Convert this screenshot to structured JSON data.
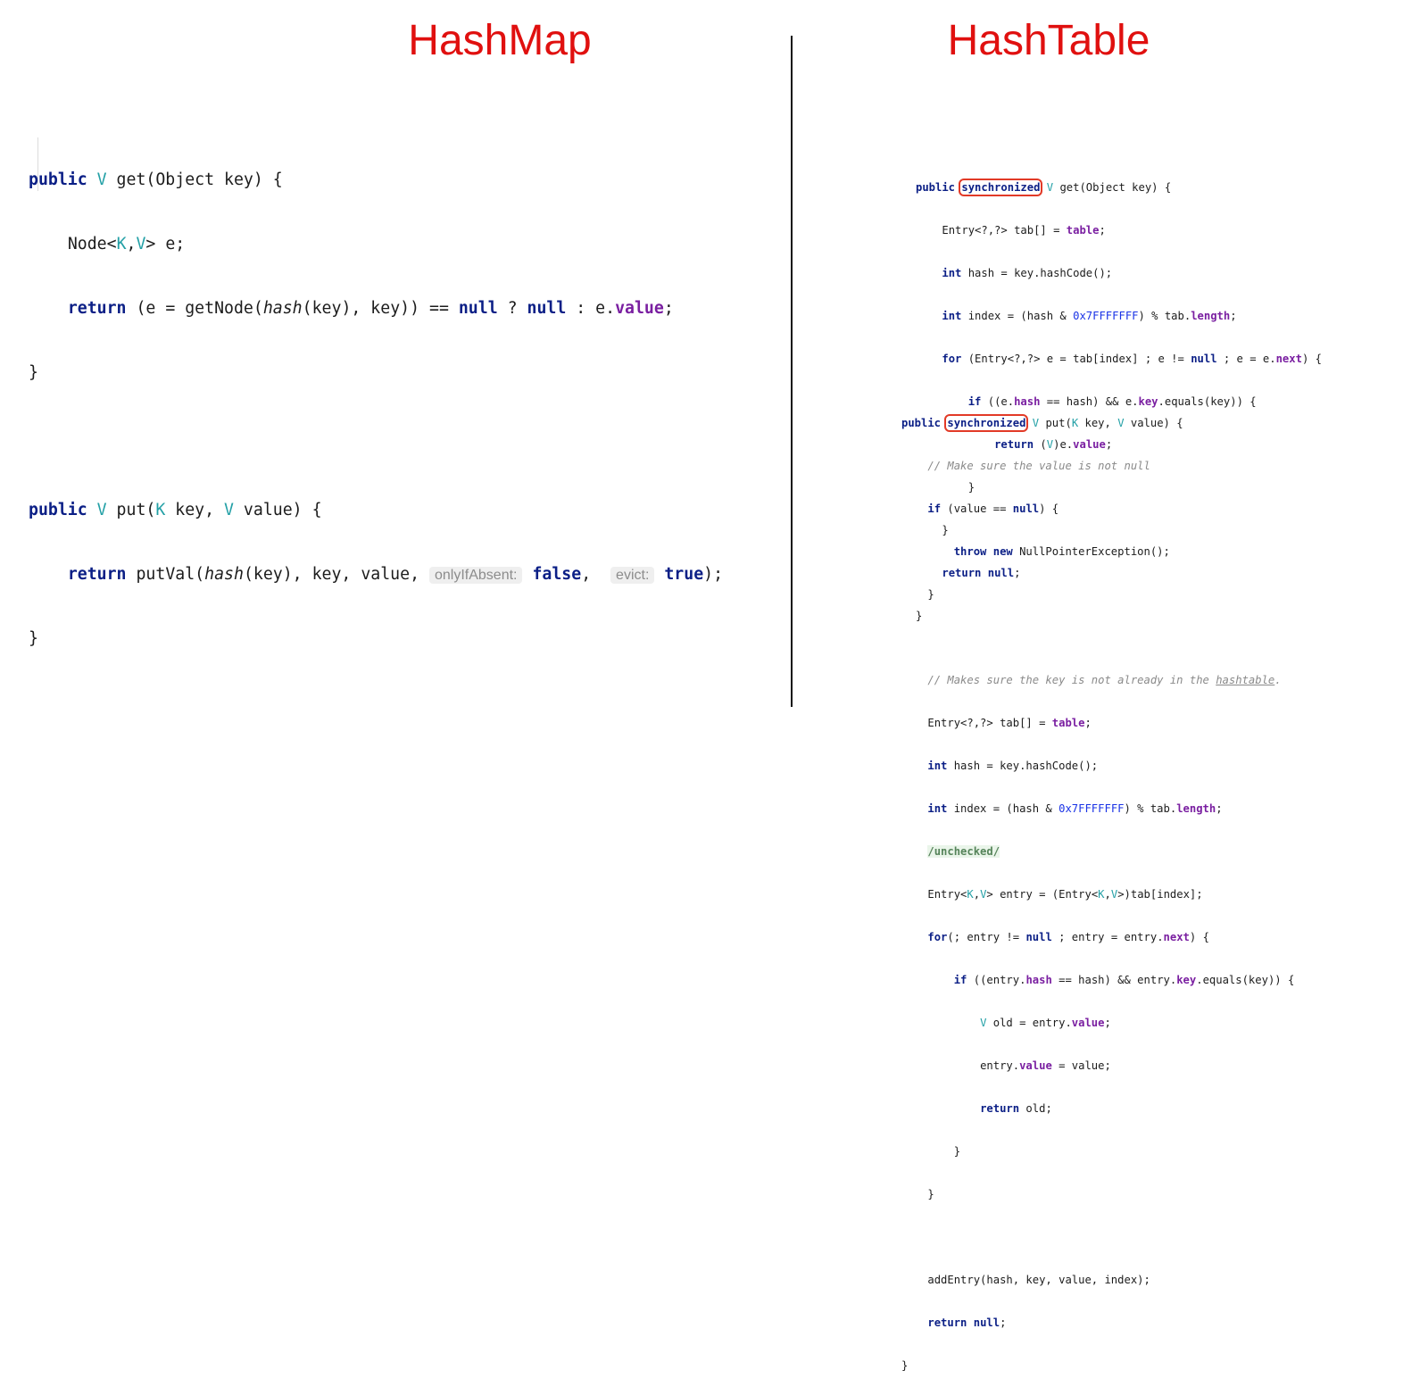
{
  "titles": {
    "left": "HashMap",
    "right": "HashTable"
  },
  "hashmap": {
    "get": {
      "l1": {
        "kw": "public",
        "type": "V",
        "rest": " get(Object key) {"
      },
      "l2": {
        "a": "Node<",
        "k": "K",
        "comma": ",",
        "v": "V",
        "b": "> e;"
      },
      "l3": {
        "ret": "return",
        "a": " (e = getNode(",
        "hash": "hash",
        "b": "(key), key)) == ",
        "null1": "null",
        "q": " ? ",
        "null2": "null",
        "c": " : e.",
        "field": "value",
        "end": ";"
      },
      "l4": "}"
    },
    "put": {
      "l1": {
        "kw": "public",
        "type": "V",
        "a": " put(",
        "k": "K",
        "b": " key, ",
        "v": "V",
        "c": " value) {"
      },
      "l2": {
        "ret": "return",
        "a": " putVal(",
        "hash": "hash",
        "b": "(key), key, value, ",
        "hint1": "onlyIfAbsent:",
        "false": "false",
        "c": ", ",
        "hint2": "evict:",
        "true": "true",
        "end": ");"
      },
      "l3": "}"
    }
  },
  "hashtable": {
    "get": {
      "l1": {
        "kw": "public",
        "sync": "synchronized",
        "type": "V",
        "rest": " get(Object key) {"
      },
      "l2": {
        "a": "Entry<?,?> tab[] = ",
        "field": "table",
        "end": ";"
      },
      "l3": {
        "kw": "int",
        "rest": " hash = key.hashCode();"
      },
      "l4": {
        "kw": "int",
        "a": " index = (hash & ",
        "num": "0x7FFFFFFF",
        "b": ") % tab.",
        "field": "length",
        "end": ";"
      },
      "l5": {
        "kw": "for",
        "a": " (Entry<?,?> e = tab[index] ; e != ",
        "null": "null",
        "b": " ; e = e.",
        "field": "next",
        "end": ") {"
      },
      "l6": {
        "kw": "if",
        "a": " ((e.",
        "f1": "hash",
        "b": " == hash) && e.",
        "f2": "key",
        "c": ".equals(key)) {"
      },
      "l7": {
        "kw": "return",
        "a": " (",
        "type": "V",
        "b": ")e.",
        "field": "value",
        "end": ";"
      },
      "l8": "}",
      "l9": "}",
      "l10": {
        "kw": "return",
        "null": "null",
        "end": ";"
      },
      "l11": "}"
    },
    "put": {
      "l1": {
        "kw": "public",
        "sync": "synchronized",
        "type": "V",
        "a": " put(",
        "k": "K",
        "b": " key, ",
        "v": "V",
        "c": " value) {"
      },
      "l2": "// Make sure the value is not null",
      "l3": {
        "kw": "if",
        "a": " (value == ",
        "null": "null",
        "b": ") {"
      },
      "l4": {
        "kw1": "throw",
        "kw2": "new",
        "rest": " NullPointerException();"
      },
      "l5": "}",
      "l7": {
        "a": "// Makes sure the key is not already in the ",
        "u": "hashtable",
        "b": "."
      },
      "l8": {
        "a": "Entry<?,?> tab[] = ",
        "field": "table",
        "end": ";"
      },
      "l9": {
        "kw": "int",
        "rest": " hash = key.hashCode();"
      },
      "l10": {
        "kw": "int",
        "a": " index = (hash & ",
        "num": "0x7FFFFFFF",
        "b": ") % tab.",
        "field": "length",
        "end": ";"
      },
      "l11": "/unchecked/",
      "l12": {
        "a": "Entry<",
        "k": "K",
        "comma": ",",
        "v": "V",
        "b": "> entry = (Entry<",
        "k2": "K",
        "comma2": ",",
        "v2": "V",
        "c": ">)tab[index];"
      },
      "l13": {
        "kw": "for",
        "a": "(; entry != ",
        "null": "null",
        "b": " ; entry = entry.",
        "field": "next",
        "end": ") {"
      },
      "l14": {
        "kw": "if",
        "a": " ((entry.",
        "f1": "hash",
        "b": " == hash) && entry.",
        "f2": "key",
        "c": ".equals(key)) {"
      },
      "l15": {
        "type": "V",
        "a": " old = entry.",
        "field": "value",
        "end": ";"
      },
      "l16": {
        "a": "entry.",
        "field": "value",
        "b": " = value;"
      },
      "l17": {
        "kw": "return",
        "rest": " old;"
      },
      "l18": "}",
      "l19": "}",
      "l21": "addEntry(hash, key, value, index);",
      "l22": {
        "kw": "return",
        "null": "null",
        "end": ";"
      },
      "l23": "}"
    }
  },
  "colors": {
    "title": "#e0100f",
    "keyword": "#0b1f86",
    "type_param": "#23a0a6",
    "field": "#7a1fa1",
    "number": "#1a33e6",
    "highlight_box": "#e23a27"
  }
}
